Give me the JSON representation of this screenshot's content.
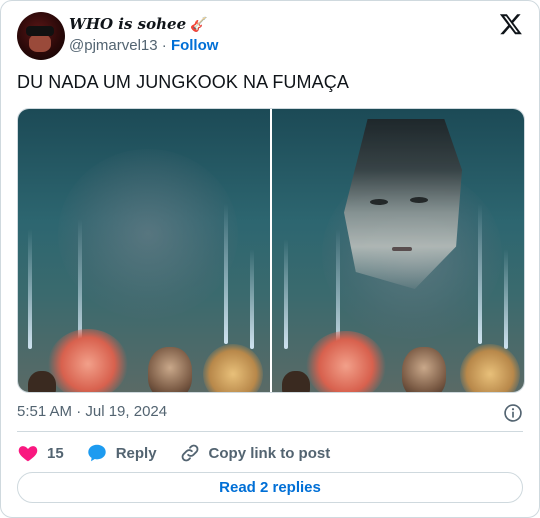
{
  "user": {
    "display_name": "WHO is sohee",
    "display_emoji": "🎸",
    "handle": "@pjmarvel13",
    "separator": "·",
    "follow_label": "Follow"
  },
  "tweet": {
    "text": "DU NADA UM JUNGKOOK NA FUMAÇA",
    "timestamp": "5:51 AM · Jul 19, 2024"
  },
  "media": {
    "images": [
      {
        "alt": "fireworks with smoke"
      },
      {
        "alt": "fireworks with face edited into smoke"
      }
    ]
  },
  "actions": {
    "like_count": "15",
    "reply_label": "Reply",
    "copy_label": "Copy link to post"
  },
  "read_replies_label": "Read 2 replies",
  "colors": {
    "accent": "#006fd6",
    "like": "#f91880",
    "reply_icon": "#1d9bf0",
    "muted": "#536471",
    "border": "#cfd9de"
  },
  "icons": [
    "x-logo-icon",
    "info-icon",
    "heart-icon",
    "reply-bubble-icon",
    "link-icon",
    "guitar-icon"
  ]
}
